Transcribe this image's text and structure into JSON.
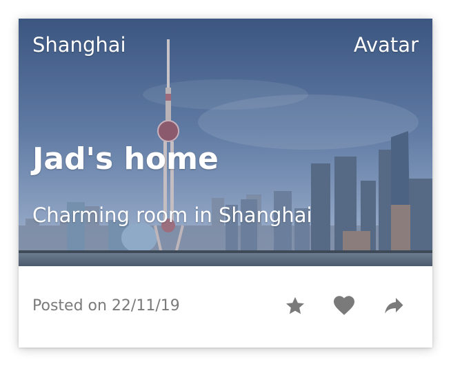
{
  "card": {
    "location": "Shanghai",
    "avatar_label": "Avatar",
    "title": "Jad's home",
    "subtitle": "Charming room in Shanghai",
    "posted": "Posted on 22/11/19"
  },
  "actions": {
    "star_icon": "star-icon",
    "heart_icon": "heart-icon",
    "share_icon": "share-icon"
  },
  "colors": {
    "icon": "#7a7a7a",
    "text_muted": "#7a7a7a",
    "overlay_text": "#ffffff"
  }
}
